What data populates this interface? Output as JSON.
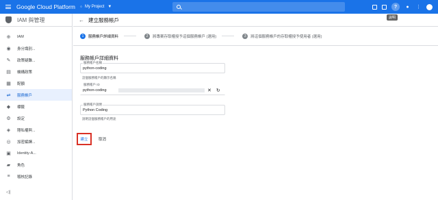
{
  "topbar": {
    "brand": "Google Cloud Platform",
    "project": "My Project",
    "tooltip": "說明"
  },
  "sidebar": {
    "title": "IAM 與管理",
    "items": [
      {
        "icon": "person-add-icon",
        "glyph": "⊕",
        "label": "IAM",
        "active": false
      },
      {
        "icon": "identity-icon",
        "glyph": "◉",
        "label": "身分識別...",
        "active": false
      },
      {
        "icon": "wrench-icon",
        "glyph": "✎",
        "label": "政策疑難...",
        "active": false
      },
      {
        "icon": "doc-icon",
        "glyph": "▤",
        "label": "機構政策",
        "active": false
      },
      {
        "icon": "quota-icon",
        "glyph": "▦",
        "label": "配額",
        "active": false
      },
      {
        "icon": "service-account-icon",
        "glyph": "⇌",
        "label": "服務帳戶",
        "active": true
      },
      {
        "icon": "label-icon",
        "glyph": "◆",
        "label": "標籤",
        "active": false
      },
      {
        "icon": "gear-icon",
        "glyph": "⚙",
        "label": "設定",
        "active": false
      },
      {
        "icon": "privacy-icon",
        "glyph": "◈",
        "label": "隱私權與...",
        "active": false
      },
      {
        "icon": "encryption-icon",
        "glyph": "◎",
        "label": "加密編譯...",
        "active": false
      },
      {
        "icon": "identity-aware-icon",
        "glyph": "▣",
        "label": "Identity-A...",
        "active": false
      },
      {
        "icon": "roles-icon",
        "glyph": "▰",
        "label": "角色",
        "active": false
      },
      {
        "icon": "audit-log-icon",
        "glyph": "≡",
        "label": "稽核記錄",
        "active": false
      }
    ],
    "collapse": "◁|"
  },
  "main": {
    "title": "建立服務帳戶",
    "steps": [
      {
        "num": "1",
        "label": "服務帳戶詳細資料"
      },
      {
        "num": "2",
        "label": "將專案存取權授予這個服務帳戶 (選用)"
      },
      {
        "num": "3",
        "label": "將這個服務帳戶的存取權授予使用者 (選用)"
      }
    ],
    "section_title": "服務帳戶詳細資料",
    "name_field": {
      "label": "服務帳戶名稱",
      "value": "python-coding",
      "hint": "這個服務帳戶的顯示名稱"
    },
    "id_field": {
      "label": "服務帳戶 ID",
      "value": "python-coding"
    },
    "desc_field": {
      "label": "服務帳戶說明",
      "value": "Python Coding",
      "hint": "說明這個服務帳戶的用途"
    },
    "create_label": "建立",
    "cancel_label": "取消"
  }
}
